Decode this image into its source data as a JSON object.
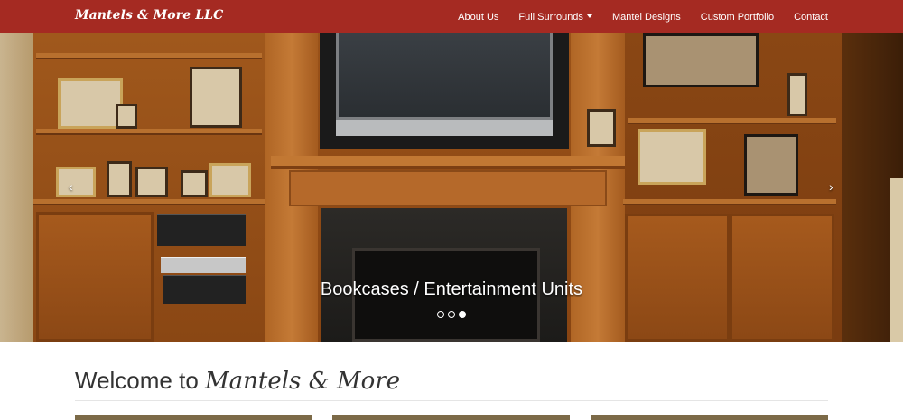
{
  "navbar": {
    "brand": "Mantels & More LLC",
    "items": [
      {
        "label": "About Us",
        "dropdown": false
      },
      {
        "label": "Full Surrounds",
        "dropdown": true
      },
      {
        "label": "Mantel Designs",
        "dropdown": false
      },
      {
        "label": "Custom Portfolio",
        "dropdown": false
      },
      {
        "label": "Contact",
        "dropdown": false
      }
    ],
    "background": "#a52a22"
  },
  "carousel": {
    "caption": "Bookcases / Entertainment Units",
    "slides_count": 3,
    "active_slide": 3,
    "prev_glyph": "‹",
    "next_glyph": "›"
  },
  "welcome": {
    "prefix": "Welcome to ",
    "name": "Mantels & More"
  },
  "icons": {
    "dropdown": "caret-down-icon",
    "prev": "chevron-left-icon",
    "next": "chevron-right-icon"
  },
  "colors": {
    "panel": "#7c6a48"
  }
}
